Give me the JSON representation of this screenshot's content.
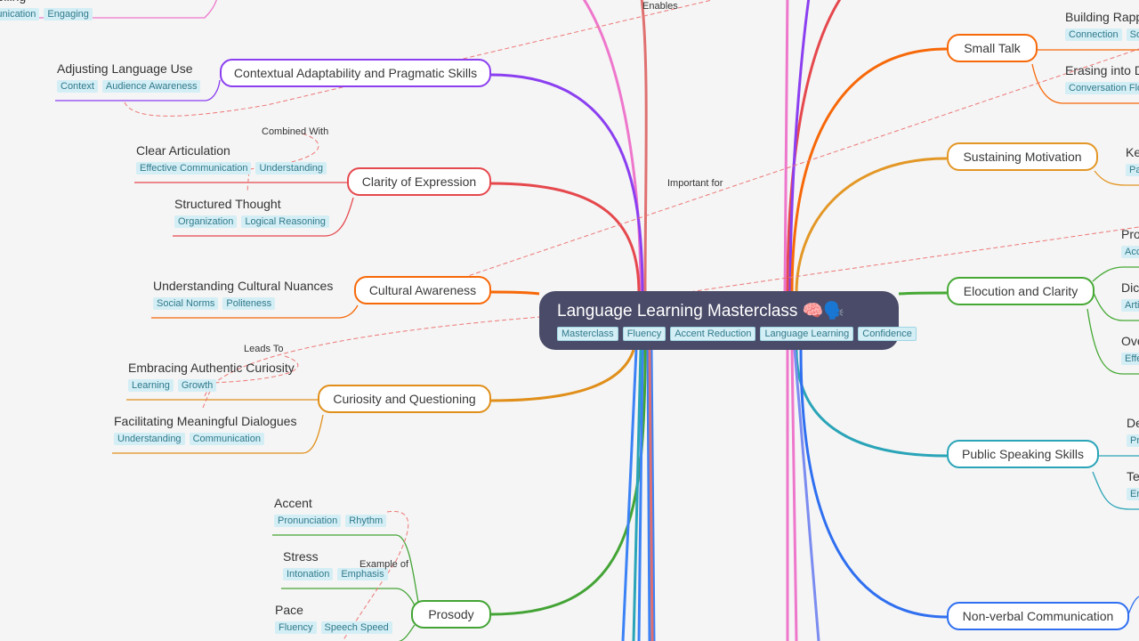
{
  "root": {
    "title": "Language Learning Masterclass 🧠🗣️",
    "tags": [
      "Masterclass",
      "Fluency",
      "Accent Reduction",
      "Language Learning",
      "Confidence"
    ]
  },
  "branches": [
    {
      "label": "Contextual Adaptability and Pragmatic Skills",
      "color": "#8b3ff0"
    },
    {
      "label": "Clarity of Expression",
      "color": "#e5484d"
    },
    {
      "label": "Cultural Awareness",
      "color": "#f76808"
    },
    {
      "label": "Curiosity and Questioning",
      "color": "#e08f1a"
    },
    {
      "label": "Prosody",
      "color": "#43a435"
    },
    {
      "label": "Small Talk",
      "color": "#f76808"
    },
    {
      "label": "Sustaining Motivation",
      "color": "#e39726"
    },
    {
      "label": "Elocution and Clarity",
      "color": "#46a935"
    },
    {
      "label": "Public Speaking Skills",
      "color": "#2aa4b8"
    },
    {
      "label": "Non-verbal Communication",
      "color": "#2f6ff0"
    }
  ],
  "leaves": [
    {
      "title": "Storytelling",
      "tags": [
        "Communication",
        "Engaging"
      ]
    },
    {
      "title": "Adjusting Language Use",
      "tags": [
        "Context",
        "Audience Awareness"
      ]
    },
    {
      "title": "Clear Articulation",
      "tags": [
        "Effective Communication",
        "Understanding"
      ]
    },
    {
      "title": "Structured Thought",
      "tags": [
        "Organization",
        "Logical Reasoning"
      ]
    },
    {
      "title": "Understanding Cultural Nuances",
      "tags": [
        "Social Norms",
        "Politeness"
      ]
    },
    {
      "title": "Embracing Authentic Curiosity",
      "tags": [
        "Learning",
        "Growth"
      ]
    },
    {
      "title": "Facilitating Meaningful Dialogues",
      "tags": [
        "Understanding",
        "Communication"
      ]
    },
    {
      "title": "Accent",
      "tags": [
        "Pronunciation",
        "Rhythm"
      ]
    },
    {
      "title": "Stress",
      "tags": [
        "Intonation",
        "Emphasis"
      ]
    },
    {
      "title": "Pace",
      "tags": [
        "Fluency",
        "Speech Speed"
      ]
    },
    {
      "title": "Building Rapport",
      "tags": [
        "Connection",
        "Social"
      ]
    },
    {
      "title": "Erasing into Deeper",
      "tags": [
        "Conversation Flow"
      ]
    },
    {
      "title": "Ke",
      "tags": [
        "Pa"
      ]
    },
    {
      "title": "Pro",
      "tags": [
        "Acc"
      ]
    },
    {
      "title": "Dic",
      "tags": [
        "Arti"
      ]
    },
    {
      "title": "Ove",
      "tags": [
        "Effe"
      ]
    },
    {
      "title": "De",
      "tags": [
        "Pr"
      ]
    },
    {
      "title": "Te",
      "tags": [
        "En"
      ]
    }
  ],
  "relations": [
    "Enables",
    "Important for",
    "Combined With",
    "Leads To",
    "Example of"
  ]
}
